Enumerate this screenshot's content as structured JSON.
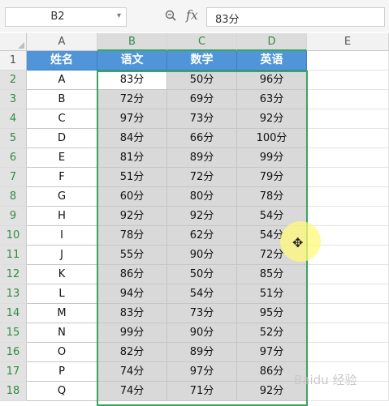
{
  "name_box": "B2",
  "formula_bar": {
    "fx": "fx",
    "value": "83分"
  },
  "columns": [
    "A",
    "B",
    "C",
    "D",
    "E"
  ],
  "selected_columns": [
    "B",
    "C",
    "D"
  ],
  "rows": [
    "1",
    "2",
    "3",
    "4",
    "5",
    "6",
    "7",
    "8",
    "9",
    "10",
    "11",
    "12",
    "13",
    "14",
    "15",
    "16",
    "17",
    "18"
  ],
  "selected_rows_from": 2,
  "header_row": [
    "姓名",
    "语文",
    "数学",
    "英语"
  ],
  "data_rows": [
    [
      "A",
      "83分",
      "50分",
      "96分"
    ],
    [
      "B",
      "72分",
      "69分",
      "63分"
    ],
    [
      "C",
      "97分",
      "73分",
      "92分"
    ],
    [
      "D",
      "84分",
      "66分",
      "100分"
    ],
    [
      "E",
      "81分",
      "89分",
      "99分"
    ],
    [
      "F",
      "51分",
      "72分",
      "79分"
    ],
    [
      "G",
      "60分",
      "80分",
      "78分"
    ],
    [
      "H",
      "92分",
      "92分",
      "54分"
    ],
    [
      "I",
      "78分",
      "62分",
      "54分"
    ],
    [
      "J",
      "55分",
      "90分",
      "72分"
    ],
    [
      "K",
      "86分",
      "50分",
      "85分"
    ],
    [
      "L",
      "94分",
      "54分",
      "51分"
    ],
    [
      "M",
      "83分",
      "73分",
      "95分"
    ],
    [
      "N",
      "99分",
      "90分",
      "52分"
    ],
    [
      "O",
      "82分",
      "89分",
      "97分"
    ],
    [
      "P",
      "74分",
      "97分",
      "86分"
    ],
    [
      "Q",
      "74分",
      "71分",
      "92分"
    ]
  ],
  "colors": {
    "header_fill": "#4f95d8",
    "selection_border": "#3aa55a",
    "selected_fill": "#d9d9d9"
  },
  "watermark": "Baidu 经验"
}
